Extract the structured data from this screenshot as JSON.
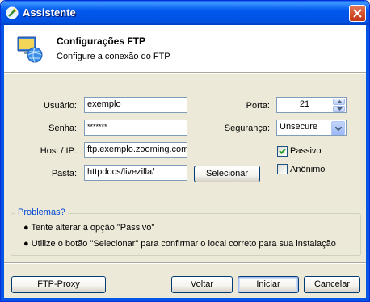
{
  "window": {
    "title": "Assistente"
  },
  "header": {
    "title": "Configurações FTP",
    "subtitle": "Configure a conexão do FTP"
  },
  "form": {
    "user_label": "Usuário:",
    "user_value": "exemplo",
    "password_label": "Senha:",
    "password_value": "*******",
    "host_label": "Host / IP:",
    "host_value": "ftp.exemplo.zooming.com.",
    "folder_label": "Pasta:",
    "folder_value": "httpdocs/livezilla/",
    "select_button": "Selecionar",
    "port_label": "Porta:",
    "port_value": "21",
    "security_label": "Segurança:",
    "security_value": "Unsecure",
    "passive_label": "Passivo",
    "passive_checked": true,
    "anonymous_label": "Anônimo",
    "anonymous_checked": false
  },
  "problems": {
    "title": "Problemas?",
    "tips": [
      "● Tente alterar a opção \"Passivo\"",
      "● Utilize o botão \"Selecionar\" para confirmar o local correto para sua instalação"
    ]
  },
  "buttons": {
    "proxy": "FTP-Proxy",
    "back": "Voltar",
    "start": "Iniciar",
    "cancel": "Cancelar"
  },
  "colors": {
    "title_bar": "#0058ee",
    "group_title": "#0046d5",
    "dialog_bg": "#ece9d8"
  }
}
